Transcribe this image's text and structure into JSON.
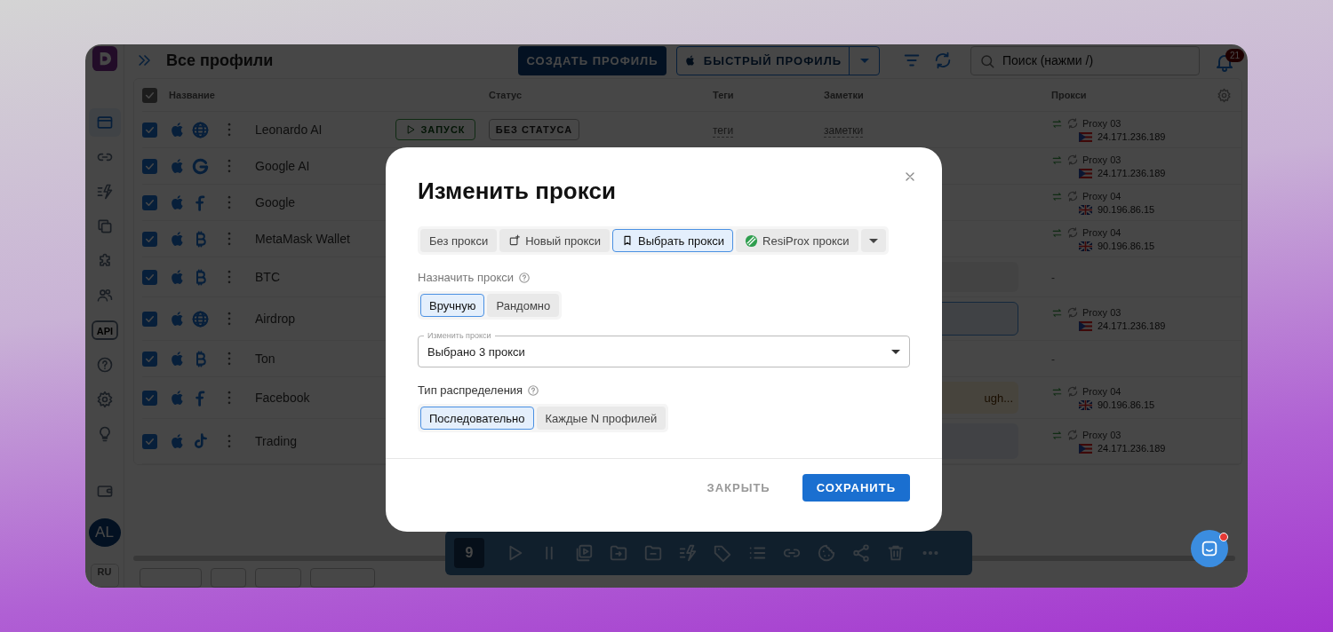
{
  "sidebar": {
    "nav": [
      {
        "kind": "window",
        "selected": true
      },
      {
        "kind": "link",
        "selected": false
      },
      {
        "kind": "bolt",
        "selected": false
      },
      {
        "kind": "copy",
        "selected": false
      },
      {
        "kind": "puzzle",
        "selected": false
      },
      {
        "kind": "users",
        "selected": false
      },
      {
        "kind": "api",
        "label": "API",
        "selected": false
      },
      {
        "kind": "help",
        "selected": false
      },
      {
        "kind": "gear",
        "selected": false
      },
      {
        "kind": "bulb",
        "selected": false
      }
    ],
    "footer_items": [
      {
        "kind": "wallet",
        "selected": false
      }
    ],
    "avatar": "AL",
    "language": "RU"
  },
  "header": {
    "title": "Все профили",
    "create_button": "СОЗДАТЬ ПРОФИЛЬ",
    "quick_button": "БЫСТРЫЙ ПРОФИЛЬ",
    "search": {
      "placeholder": "Поиск (нажми /)"
    },
    "notifications": "21"
  },
  "table": {
    "select_all_checked": true,
    "columns": [
      "Название",
      "Статус",
      "Теги",
      "Заметки",
      "Прокси"
    ],
    "rows": [
      {
        "name": "Leonardo AI",
        "checked": true,
        "kind": "globe",
        "launch": "ЗАПУСК",
        "status": "БЕЗ СТАТУСА",
        "tags": "теги",
        "notes": "заметки",
        "proxy": {
          "name": "Proxy 03",
          "ip": "24.171.236.189",
          "kind": "pr"
        }
      },
      {
        "name": "Google AI",
        "checked": true,
        "kind": "google",
        "proxy": {
          "name": "Proxy 03",
          "ip": "24.171.236.189",
          "kind": "pr"
        }
      },
      {
        "name": "Google",
        "checked": true,
        "kind": "facebook",
        "proxy": {
          "name": "Proxy 04",
          "ip": "90.196.86.15",
          "kind": "uk"
        }
      },
      {
        "name": "MetaMask Wallet",
        "checked": true,
        "kind": "bitcoin",
        "proxy": {
          "name": "Proxy 04",
          "ip": "90.196.86.15",
          "kind": "uk"
        }
      },
      {
        "name": "BTC",
        "checked": true,
        "kind": "bitcoin",
        "note": {
          "kind": "plain"
        },
        "proxy_text": "-"
      },
      {
        "name": "Airdrop",
        "checked": true,
        "kind": "globe",
        "note": {
          "kind": "selected"
        },
        "proxy": {
          "name": "Proxy 03",
          "ip": "24.171.236.189",
          "kind": "pr"
        }
      },
      {
        "name": "Ton",
        "checked": true,
        "kind": "bitcoin",
        "proxy_text": "-"
      },
      {
        "name": "Facebook",
        "checked": true,
        "kind": "facebook",
        "note": {
          "kind": "warning",
          "text": "ugh..."
        },
        "proxy": {
          "name": "Proxy 04",
          "ip": "90.196.86.15",
          "kind": "uk"
        }
      },
      {
        "name": "Trading",
        "checked": true,
        "kind": "tiktok",
        "note": {
          "kind": "info"
        },
        "proxy": {
          "name": "Proxy 03",
          "ip": "24.171.236.189",
          "kind": "pr"
        }
      }
    ]
  },
  "bulk_toolbar": {
    "count": "9",
    "actions": [
      {
        "kind": "play"
      },
      {
        "kind": "pause"
      },
      {
        "kind": "video"
      },
      {
        "kind": "folder-in"
      },
      {
        "kind": "folder-minus"
      },
      {
        "kind": "bolt"
      },
      {
        "kind": "tag"
      },
      {
        "kind": "list"
      },
      {
        "kind": "link"
      },
      {
        "kind": "cookie"
      },
      {
        "kind": "share"
      },
      {
        "kind": "trash"
      },
      {
        "kind": "more"
      }
    ]
  },
  "dialog": {
    "title": "Изменить прокси",
    "proxy_modes": [
      {
        "label": "Без прокси",
        "kind": "plain",
        "selected": false
      },
      {
        "label": "Новый прокси",
        "kind": "new",
        "selected": false
      },
      {
        "label": "Выбрать прокси",
        "kind": "saved",
        "selected": true
      },
      {
        "label": "ResiProx прокси",
        "kind": "resiprox",
        "selected": false
      }
    ],
    "assign": {
      "label": "Назначить прокси",
      "options": [
        {
          "label": "Вручную",
          "selected": true
        },
        {
          "label": "Рандомно",
          "selected": false
        }
      ]
    },
    "proxy_select": {
      "label": "Изменить прокси",
      "value": "Выбрано 3 прокси"
    },
    "distribution": {
      "label": "Тип распределения",
      "options": [
        {
          "label": "Последовательно",
          "selected": true
        },
        {
          "label": "Каждые N профилей",
          "selected": false
        }
      ]
    },
    "buttons": [
      {
        "label": "ЗАКРЫТЬ",
        "kind": "text"
      },
      {
        "label": "СОХРАНИТЬ",
        "kind": "primary"
      }
    ]
  }
}
